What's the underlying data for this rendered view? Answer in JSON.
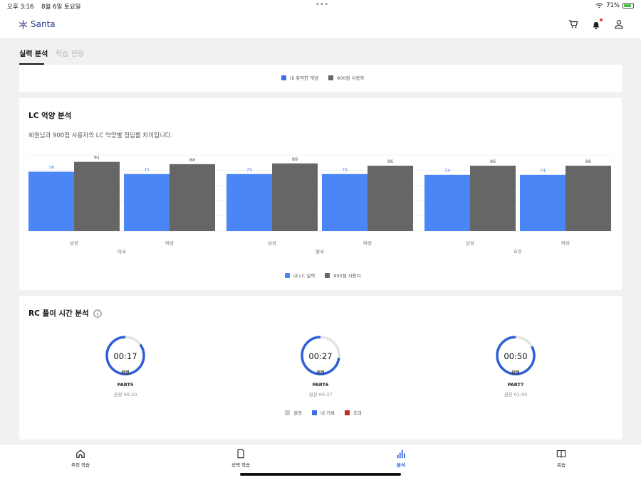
{
  "status_bar": {
    "time": "오후 3:16",
    "date": "8월 6일 토요일",
    "battery": "71%",
    "battery_level": 0.71
  },
  "app": {
    "brand": "Santa"
  },
  "tabs": [
    {
      "label": "실력 분석",
      "active": true
    },
    {
      "label": "학습 현황",
      "active": false
    }
  ],
  "top_legend": [
    {
      "label": "내 취약한 개념",
      "color": "#3d6fe0"
    },
    {
      "label": "900점 사용자",
      "color": "#666666"
    }
  ],
  "lc": {
    "title": "LC 억양 분석",
    "description": "회원님과 900점 사용자의 LC 억양별 정답률 차이입니다.",
    "legend": [
      {
        "label": "내 LC 실력",
        "color": "#4a86f5"
      },
      {
        "label": "900점 사용자",
        "color": "#666666"
      }
    ]
  },
  "chart_data": {
    "type": "bar",
    "groups": [
      "미국",
      "영국",
      "호주"
    ],
    "categories": [
      "남성",
      "여성",
      "남성",
      "여성",
      "남성",
      "여성"
    ],
    "category_group": [
      "미국",
      "미국",
      "영국",
      "영국",
      "호주",
      "호주"
    ],
    "series": [
      {
        "name": "내 LC 실력",
        "color": "#4a86f5",
        "values": [
          78,
          75,
          75,
          75,
          74,
          74
        ]
      },
      {
        "name": "900점 사용자",
        "color": "#666666",
        "values": [
          91,
          88,
          89,
          86,
          86,
          86
        ]
      }
    ],
    "ylim": [
      0,
      100
    ],
    "grid": true
  },
  "rc": {
    "title": "RC 풀이 시간 분석",
    "timers": [
      {
        "time": "00:17",
        "status": "안정",
        "part": "PART5",
        "recommended": "권장 00:20",
        "fraction": 0.85
      },
      {
        "time": "00:27",
        "status": "안정",
        "part": "PART6",
        "recommended": "권장 00:37",
        "fraction": 0.73
      },
      {
        "time": "00:50",
        "status": "안정",
        "part": "PART7",
        "recommended": "권장 01:00",
        "fraction": 0.83
      }
    ],
    "legend": [
      {
        "label": "권장",
        "color": "#cccccc"
      },
      {
        "label": "내 기록",
        "color": "#3d6fe0"
      },
      {
        "label": "초과",
        "color": "#c62828"
      }
    ]
  },
  "bottom_nav": [
    {
      "label": "추천 학습",
      "icon": "home-icon",
      "active": false
    },
    {
      "label": "선택 학습",
      "icon": "book-page-icon",
      "active": false
    },
    {
      "label": "분석",
      "icon": "bar-chart-icon",
      "active": true
    },
    {
      "label": "복습",
      "icon": "open-book-icon",
      "active": false
    }
  ]
}
